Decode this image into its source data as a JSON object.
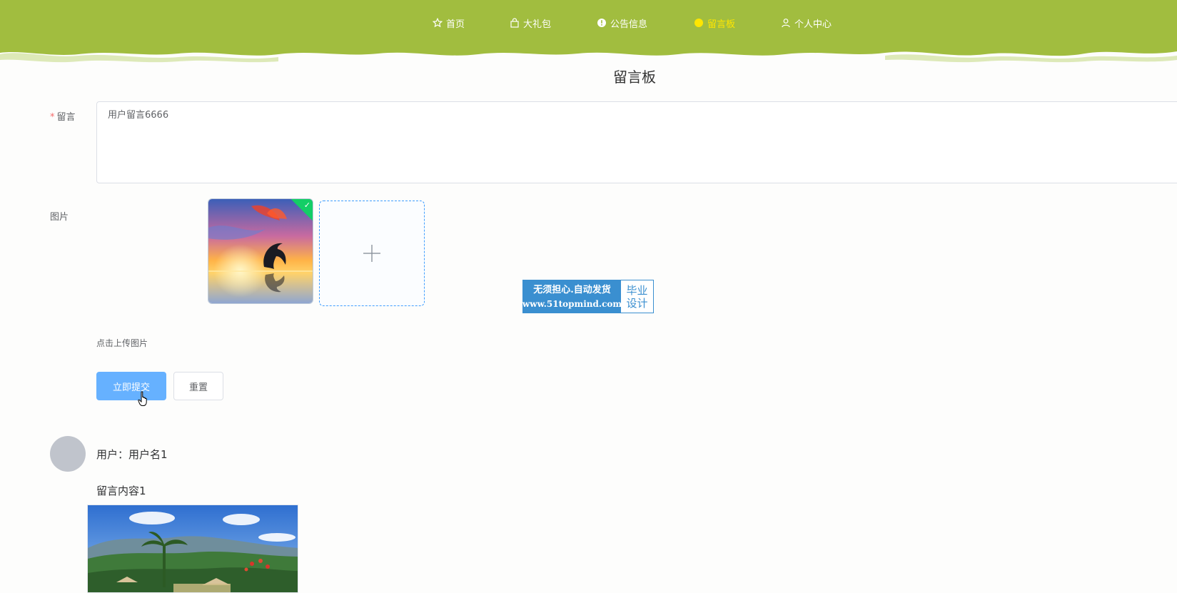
{
  "nav": {
    "items": [
      {
        "label": "首页",
        "icon": "star-icon",
        "active": false
      },
      {
        "label": "大礼包",
        "icon": "bag-icon",
        "active": false
      },
      {
        "label": "公告信息",
        "icon": "info-icon",
        "active": false
      },
      {
        "label": "留言板",
        "icon": "dot-icon",
        "active": true
      },
      {
        "label": "个人中心",
        "icon": "user-icon",
        "active": false
      }
    ],
    "colors": {
      "header_bg": "#a1bd3f",
      "active": "#ffe600",
      "text": "#ffffff"
    }
  },
  "page": {
    "title": "留言板"
  },
  "form": {
    "message_label": "留言",
    "required_mark": "*",
    "message_value": "用户留言6666",
    "image_label": "图片",
    "upload_hint": "点击上传图片",
    "submit_label": "立即提交",
    "reset_label": "重置"
  },
  "watermark": {
    "line1": "无须担心.自动发货",
    "line2": "www.51topmind.com",
    "side_top": "毕业",
    "side_bottom": "设计"
  },
  "messages": [
    {
      "user": "用户：用户名1",
      "content": "留言内容1"
    }
  ],
  "colors": {
    "primary": "#66b1ff",
    "success": "#13ce66"
  }
}
